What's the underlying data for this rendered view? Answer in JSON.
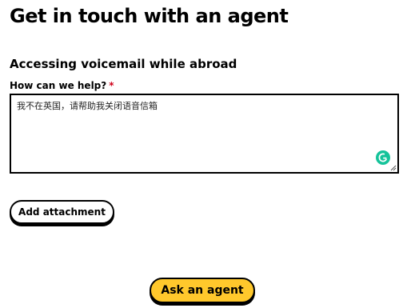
{
  "header": {
    "title": "Get in touch with an agent"
  },
  "form": {
    "topic": "Accessing voicemail while abroad",
    "help_label": "How can we help?",
    "required_marker": "*",
    "message_value": "我不在英国，请帮助我关闭语音信箱",
    "grammarly_letter": "G",
    "grammarly_color": "#15c39a"
  },
  "actions": {
    "attachment_label": "Add attachment",
    "submit_label": "Ask an agent",
    "submit_color": "#ffc82c"
  }
}
